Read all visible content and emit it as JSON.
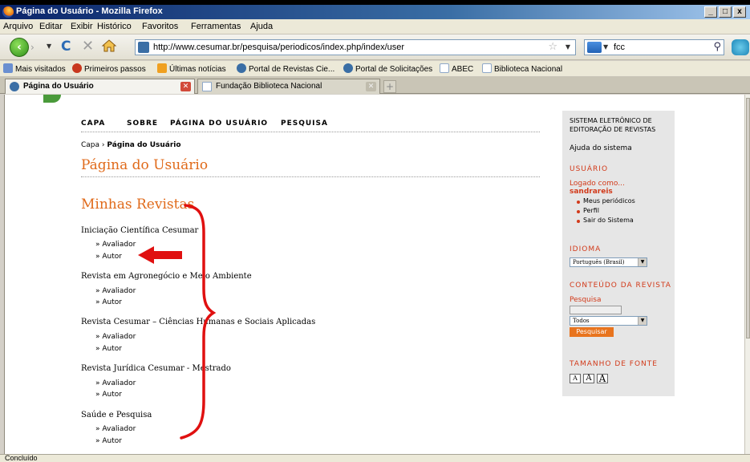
{
  "window": {
    "title": "Página do Usuário - Mozilla Firefox",
    "controls": [
      "_",
      "□",
      "x"
    ]
  },
  "menu": [
    "Arquivo",
    "Editar",
    "Exibir",
    "Histórico",
    "Favoritos",
    "Ferramentas",
    "Ajuda"
  ],
  "toolbar": {
    "url": "http://www.cesumar.br/pesquisa/periodicos/index.php/index/user",
    "search_value": "fcc"
  },
  "bookmarks": [
    "Mais visitados",
    "Primeiros passos",
    "Últimas notícias",
    "Portal de Revistas Cie...",
    "Portal de Solicitações",
    "ABEC",
    "Biblioteca Nacional"
  ],
  "tabs": [
    {
      "label": "Página do Usuário",
      "active": true
    },
    {
      "label": "Fundação Biblioteca Nacional",
      "active": false
    }
  ],
  "page": {
    "nav": [
      "CAPA",
      "SOBRE",
      "PÁGINA DO USUÁRIO",
      "PESQUISA"
    ],
    "breadcrumb_home": "Capa",
    "breadcrumb_sep": "›",
    "breadcrumb_current": "Página do Usuário",
    "title": "Página do Usuário",
    "section_title": "Minhas Revistas",
    "journals": [
      {
        "name": "Iniciação Científica Cesumar",
        "roles": [
          "Avaliador",
          "Autor"
        ]
      },
      {
        "name": "Revista em Agronegócio e Meio Ambiente",
        "roles": [
          "Avaliador",
          "Autor"
        ]
      },
      {
        "name": "Revista Cesumar – Ciências Humanas e Sociais Aplicadas",
        "roles": [
          "Avaliador",
          "Autor"
        ]
      },
      {
        "name": "Revista Jurídica Cesumar - Mestrado",
        "roles": [
          "Avaliador",
          "Autor"
        ]
      },
      {
        "name": "Saúde e Pesquisa",
        "roles": [
          "Avaliador",
          "Autor"
        ]
      }
    ],
    "role_prefix": "»"
  },
  "sidebar": {
    "system_line1": "SISTEMA ELETRÔNICO DE",
    "system_line2": "EDITORAÇÃO DE REVISTAS",
    "help": "Ajuda do sistema",
    "user_head": "USUÁRIO",
    "logged_as": "Logado como...",
    "username": "sandrareis",
    "user_links": [
      "Meus periódicos",
      "Perfil",
      "Sair do Sistema"
    ],
    "language_head": "IDIOMA",
    "language_value": "Português (Brasil)",
    "content_head": "CONTEÚDO DA REVISTA",
    "search_label": "Pesquisa",
    "search_scope": "Todos",
    "search_button": "Pesquisar",
    "font_head": "TAMANHO DE FONTE",
    "font_sizes": [
      "A",
      "A",
      "A"
    ]
  },
  "status": "Concluído",
  "colors": {
    "accent": "#e06a1a",
    "sidebar_heading": "#d23a1a",
    "annotation": "#e01010"
  }
}
